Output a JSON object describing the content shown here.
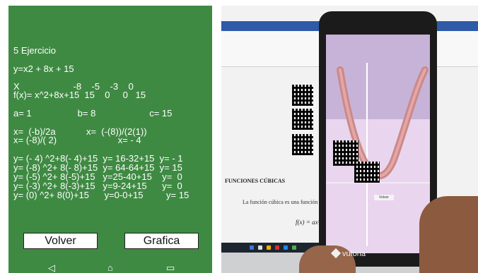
{
  "app": {
    "lines": [
      "5 Ejercicio",
      "y=x2 + 8x + 15",
      "X                     -8    -5    -3    0",
      "f(x)= x^2+8x+15  15    0     0   15",
      "a= 1                  b= 8                     c= 15",
      "x=  (-b)/2a            x=  (-(8))/(2(1))",
      "x= (-8)/( 2)                        x= - 4",
      "y= (- 4) ^2+8(- 4)+15  y= 16-32+15  y= - 1",
      "y= (-8) ^2+ 8(- 8)+15  y= 64-64+15  y= 15",
      "y= (-5) ^2+ 8(-5)+15   y=25-40+15    y=  0",
      "y= (-3) ^2+ 8(-3)+15   y=9-24+15      y=  0",
      "y= (0) ^2+ 8(0)+15      y=0-0+15         y= 15"
    ],
    "buttons": {
      "back": "Volver",
      "graph": "Grafica"
    },
    "nav": {
      "back": "◁",
      "home": "⌂",
      "recent": "▭"
    }
  },
  "photo": {
    "doc_heading": "FUNCIONES CÚBICAS",
    "doc_text": "La función cúbica es una función",
    "doc_formula": "f(x) = ax³",
    "phone_button": "Volver",
    "brand": "vuforia"
  }
}
